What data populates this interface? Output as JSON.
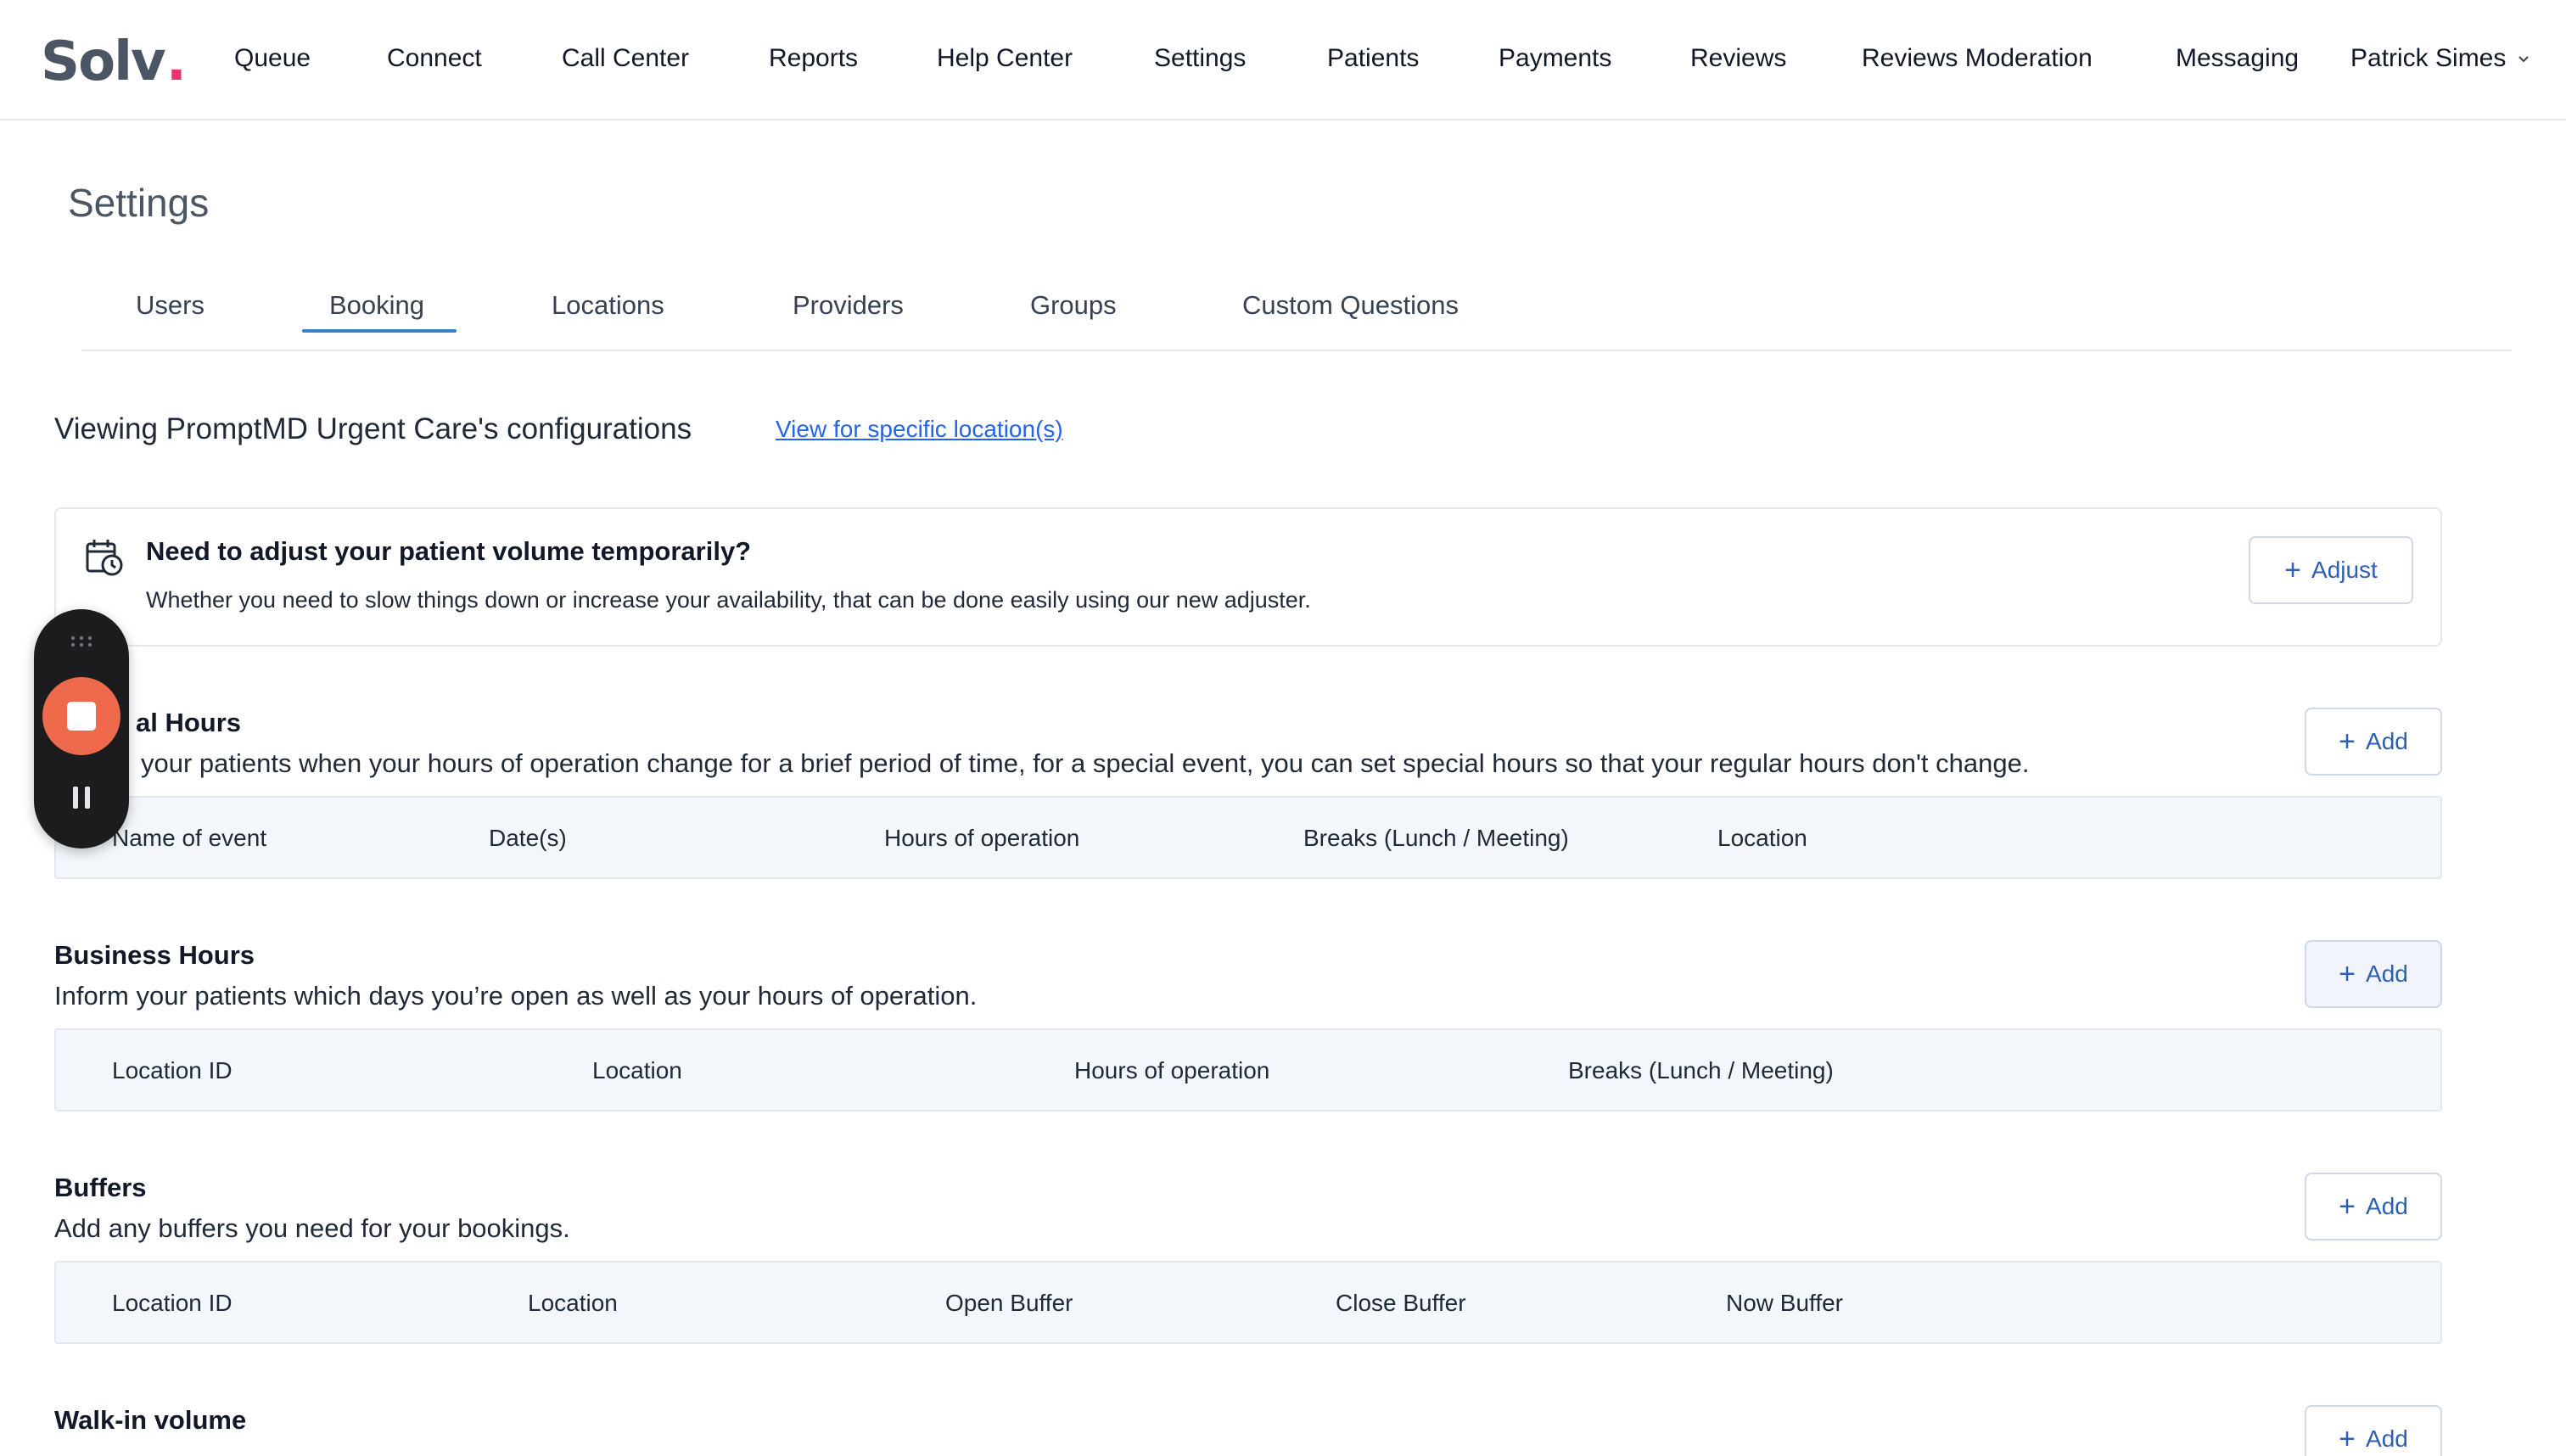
{
  "app": {
    "logo_text": "Solv",
    "logo_dot": ".",
    "brand_color": "#e8356d",
    "accent_color": "#2f5fb0"
  },
  "nav": {
    "items": [
      "Queue",
      "Connect",
      "Call Center",
      "Reports",
      "Help Center",
      "Settings",
      "Patients",
      "Payments",
      "Reviews",
      "Reviews Moderation",
      "Messaging"
    ],
    "user_name": "Patrick Simes",
    "user_icon": "chevron-down-icon"
  },
  "page": {
    "title": "Settings",
    "tabs": [
      "Users",
      "Booking",
      "Locations",
      "Providers",
      "Groups",
      "Custom Questions"
    ],
    "active_tab": "Booking",
    "viewing_text": "Viewing PromptMD Urgent Care's configurations",
    "viewing_link": "View for specific location(s)"
  },
  "banner": {
    "icon": "calendar-clock-icon",
    "title": "Need to adjust your patient volume temporarily?",
    "description": "Whether you need to slow things down or increase your availability, that can be done easily using our new adjuster.",
    "button_label": "Adjust"
  },
  "sections": [
    {
      "title": "al Hours",
      "description": "your patients when your hours of operation change for a brief period of time, for a special event, you can set special hours so that your regular hours don't change.",
      "button_label": "Add",
      "columns": [
        "Name of event",
        "Date(s)",
        "Hours of operation",
        "Breaks (Lunch / Meeting)",
        "Location"
      ]
    },
    {
      "title": "Business Hours",
      "description": "Inform your patients which days you’re open as well as your hours of operation.",
      "button_label": "Add",
      "columns": [
        "Location ID",
        "Location",
        "Hours of operation",
        "Breaks (Lunch / Meeting)"
      ]
    },
    {
      "title": "Buffers",
      "description": "Add any buffers you need for your bookings.",
      "button_label": "Add",
      "columns": [
        "Location ID",
        "Location",
        "Open Buffer",
        "Close Buffer",
        "Now Buffer"
      ]
    },
    {
      "title": "Walk-in volume",
      "button_label": "Add"
    }
  ],
  "recorder": {
    "grip_icon": "grip-dots-icon",
    "stop_icon": "stop-icon",
    "pause_icon": "pause-icon",
    "stop_color": "#ef6a4c"
  }
}
